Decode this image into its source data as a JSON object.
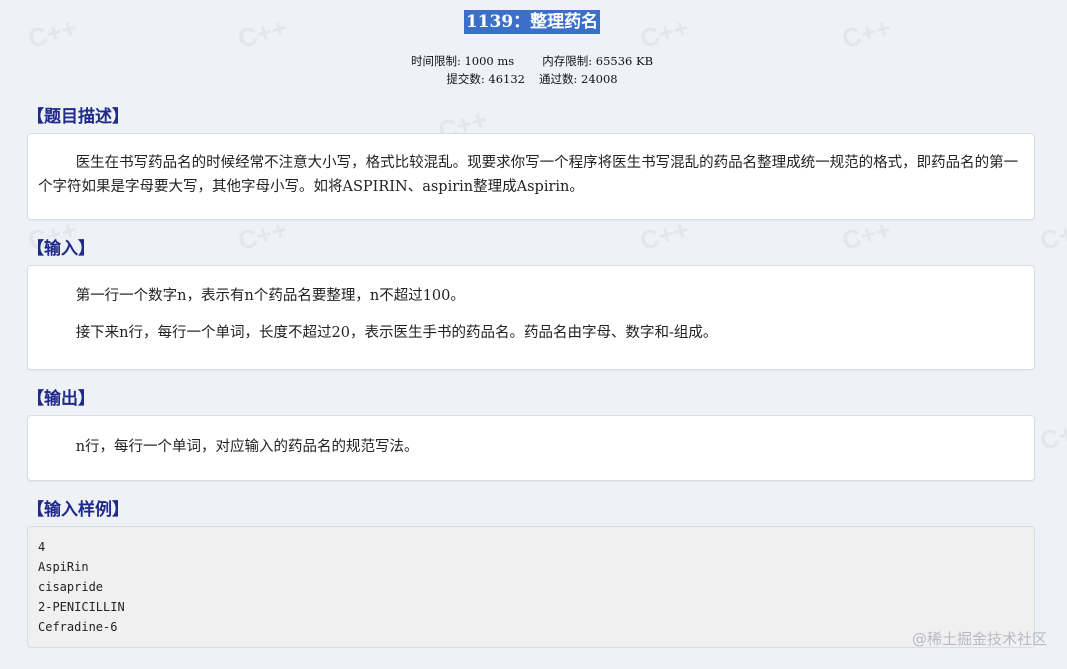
{
  "problem": {
    "title": "1139：整理药名",
    "time_limit": "时间限制: 1000 ms",
    "memory_limit": "内存限制: 65536 KB",
    "submissions": "提交数: 46132",
    "accepted": "通过数: 24008"
  },
  "sections": {
    "description": {
      "heading": "【题目描述】",
      "text": "医生在书写药品名的时候经常不注意大小写，格式比较混乱。现要求你写一个程序将医生书写混乱的药品名整理成统一规范的格式，即药品名的第一个字符如果是字母要大写，其他字母小写。如将ASPIRIN、aspirin整理成Aspirin。"
    },
    "input": {
      "heading": "【输入】",
      "line1": "第一行一个数字n，表示有n个药品名要整理，n不超过100。",
      "line2": "接下来n行，每行一个单词，长度不超过20，表示医生手书的药品名。药品名由字母、数字和-组成。"
    },
    "output": {
      "heading": "【输出】",
      "text": "n行，每行一个单词，对应输入的药品名的规范写法。"
    },
    "sample_input": {
      "heading": "【输入样例】",
      "lines": [
        "4",
        "AspiRin",
        "cisapride",
        "2-PENICILLIN",
        "Cefradine-6"
      ]
    }
  },
  "watermark": {
    "text": "@稀土掘金技术社区",
    "pattern_text": "C++"
  }
}
